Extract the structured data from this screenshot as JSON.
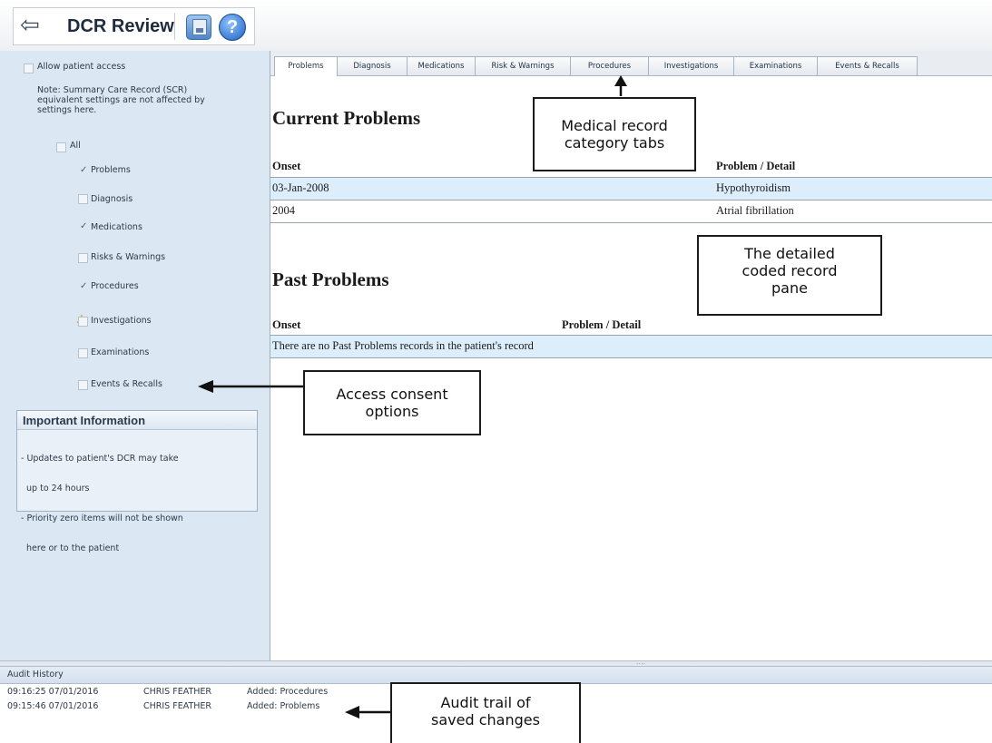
{
  "header": {
    "title": "DCR Review",
    "back_icon": "back-arrow-icon",
    "save_icon": "save-icon",
    "help_icon": "help-icon",
    "help_glyph": "?"
  },
  "left": {
    "allow_access": "Allow patient access",
    "note": [
      "Note: Summary Care Record (SCR)",
      "equivalent settings are not affected by",
      "settings here."
    ],
    "options": [
      {
        "label": "All",
        "checked": false
      },
      {
        "label": "Problems",
        "checked": true
      },
      {
        "label": "Diagnosis",
        "checked": false
      },
      {
        "label": "Medications",
        "checked": true
      },
      {
        "label": "Risks & Warnings",
        "checked": false
      },
      {
        "label": "Procedures",
        "checked": true
      },
      {
        "label": "Investigations",
        "checked": false,
        "warning": true
      },
      {
        "label": "Examinations",
        "checked": false
      },
      {
        "label": "Events & Recalls",
        "checked": false
      }
    ],
    "info": {
      "title": "Important Information",
      "lines": [
        "- Updates to patient's DCR may take",
        "  up to 24 hours",
        "- Priority zero items will not be shown",
        "  here or to the patient"
      ]
    }
  },
  "tabs": [
    "Problems",
    "Diagnosis",
    "Medications",
    "Risk & Warnings",
    "Procedures",
    "Investigations",
    "Examinations",
    "Events & Recalls"
  ],
  "content": {
    "current_title": "Current Problems",
    "past_title": "Past Problems",
    "col_onset": "Onset",
    "col_problem": "Problem / Detail",
    "current_rows": [
      {
        "onset": "03-Jan-2008",
        "problem": "Hypothyroidism"
      },
      {
        "onset": "2004",
        "problem": "Atrial fibrillation"
      }
    ],
    "past_empty": "There are no Past Problems records in the patient's record"
  },
  "audit": {
    "label": "Audit History",
    "grip": "....",
    "rows": [
      {
        "time": "09:16:25 07/01/2016",
        "user": "CHRIS FEATHER",
        "action": "Added: Procedures"
      },
      {
        "time": "09:15:46 07/01/2016",
        "user": "CHRIS FEATHER",
        "action": "Added: Problems"
      }
    ]
  },
  "callouts": {
    "tabs": [
      "Medical record",
      "category tabs"
    ],
    "pane": [
      "The detailed",
      "coded record",
      "pane"
    ],
    "consent": [
      "Access consent",
      "options"
    ],
    "audit": [
      "Audit trail of",
      "saved changes"
    ]
  }
}
